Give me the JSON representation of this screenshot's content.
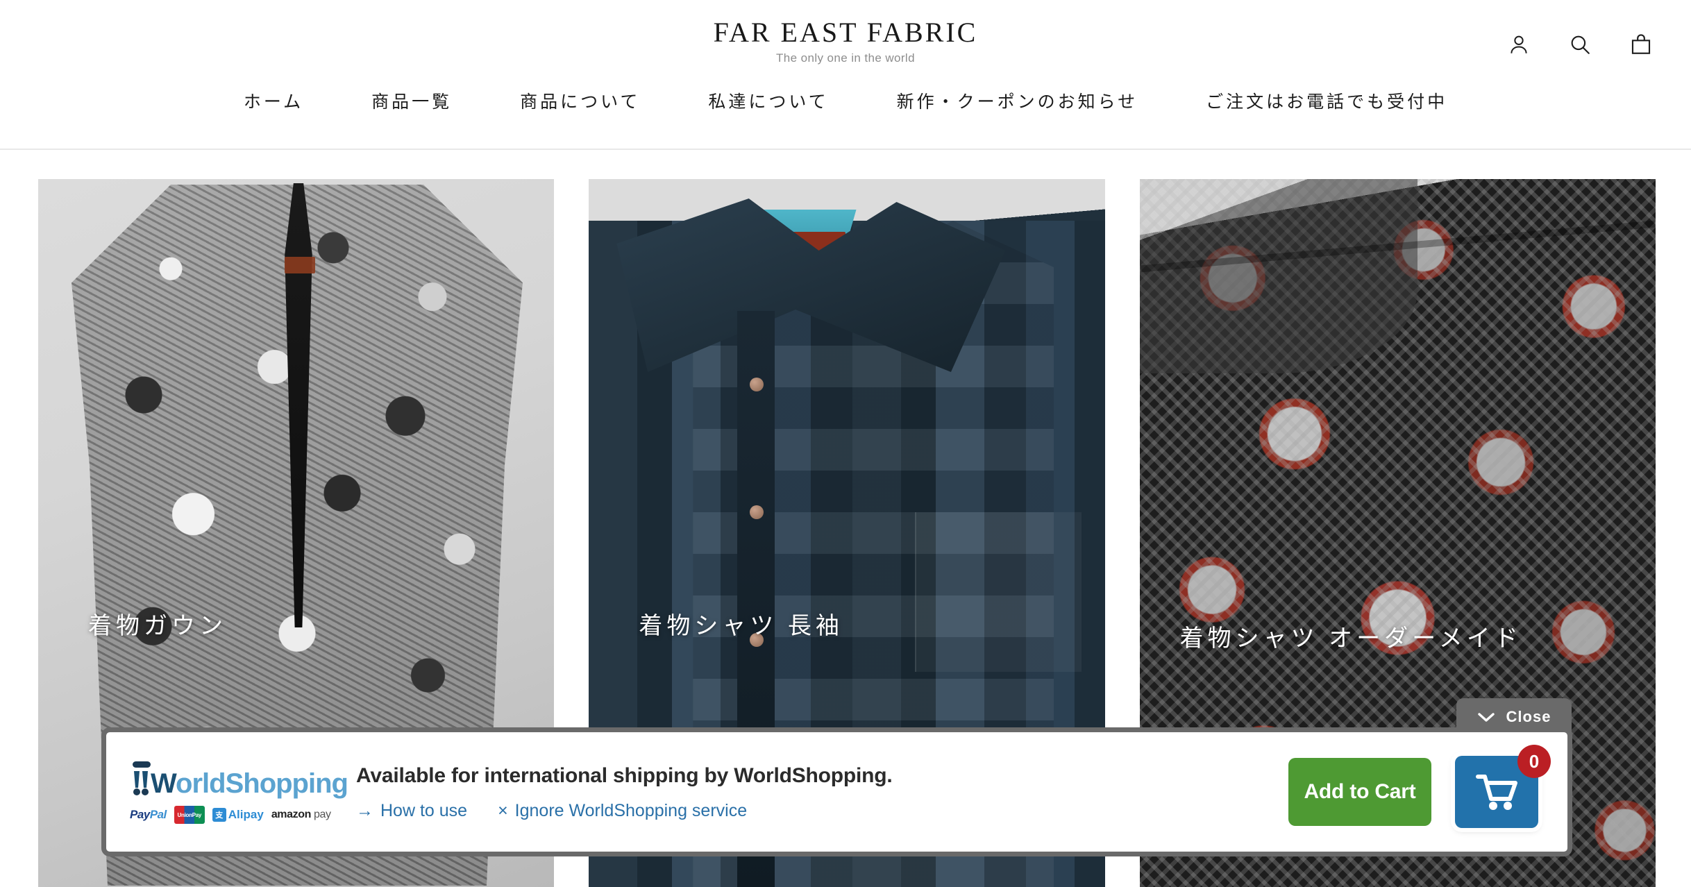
{
  "header": {
    "brand_title": "FAR EAST FABRIC",
    "brand_tagline": "The only one in the world",
    "icons": [
      {
        "name": "account-icon",
        "label": "Account"
      },
      {
        "name": "search-icon",
        "label": "Search"
      },
      {
        "name": "cart-bag-icon",
        "label": "Cart"
      }
    ],
    "nav": [
      {
        "label": "ホーム"
      },
      {
        "label": "商品一覧"
      },
      {
        "label": "商品について"
      },
      {
        "label": "私達について"
      },
      {
        "label": "新作・クーポンのお知らせ"
      },
      {
        "label": "ご注文はお電話でも受付中"
      }
    ]
  },
  "products": [
    {
      "caption": "着物ガウン"
    },
    {
      "caption": "着物シャツ 長袖"
    },
    {
      "caption": "着物シャツ オーダーメイド"
    }
  ],
  "close_tab": {
    "label": "Close",
    "icon": "chevron-down-icon"
  },
  "worldshopping": {
    "logo_first": "W",
    "logo_rest": "orldShopping",
    "payments": [
      {
        "name": "paypal",
        "text_a": "Pay",
        "text_b": "Pal"
      },
      {
        "name": "unionpay",
        "text": "UnionPay"
      },
      {
        "name": "alipay",
        "mark": "支",
        "text": "Alipay"
      },
      {
        "name": "amazonpay",
        "text_a": "amazon",
        "text_b": "pay"
      }
    ],
    "headline": "Available for international shipping by WorldShopping.",
    "link_how_to_use": "How to use",
    "link_how_to_use_icon": "→",
    "link_ignore": "Ignore WorldShopping service",
    "link_ignore_icon": "×",
    "add_to_cart_label": "Add to Cart",
    "cart_count": "0",
    "colors": {
      "add_to_cart_bg": "#4e9a33",
      "cart_bg": "#2272ab",
      "badge_bg": "#bb1f24",
      "link": "#2a70a8",
      "border": "#6a6a6a"
    }
  }
}
